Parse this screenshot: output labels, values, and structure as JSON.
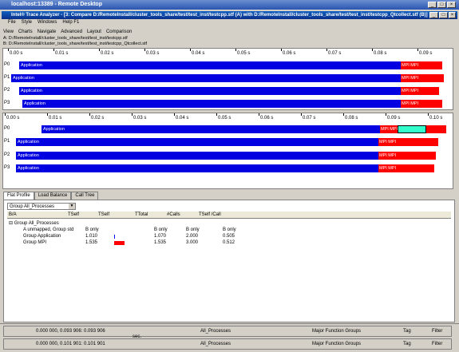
{
  "window_title": "localhost:13389 - Remote Desktop",
  "app_title": "Intel® Trace Analyzer - [3: Compare D:/RemoteInstall/cluster_tools_share/test/test_inst/testcpp.stf (A) with D:/RemoteInstall/cluster_tools_share/test/test_inst/testcpp_Qtcollect.stf (B)]",
  "menu": [
    "File",
    "Style",
    "Windows",
    "Help F1"
  ],
  "view_menu": [
    "View",
    "Charts",
    "Navigate",
    "Advanced",
    "Layout",
    "Comparison"
  ],
  "path_a": "A: D:/RemoteInstall/cluster_tools_share/test/test_inst/testcpp.stf",
  "path_b": "B: D:/RemoteInstall/cluster_tools_share/test/test_inst/testcpp_Qtcollect.stf",
  "top_ticks": [
    "0.00 s",
    "0.01 s",
    "0.02 s",
    "0.03 s",
    "0.04 s",
    "0.05 s",
    "0.06 s",
    "0.07 s",
    "0.08 s",
    "0.09 s"
  ],
  "bottom_ticks": [
    "0.00 s",
    "0.01 s",
    "0.02 s",
    "0.03 s",
    "0.04 s",
    "0.05 s",
    "0.06 s",
    "0.07 s",
    "0.08 s",
    "0.09 s",
    "0.10 s"
  ],
  "processes": [
    "P0",
    "P1",
    "P2",
    "P3"
  ],
  "app_label": "Application",
  "mpi_label": "MPI",
  "tabs": [
    "Flat Profile",
    "Load Balance",
    "Call Tree"
  ],
  "group_select": "Group All_Processes",
  "columns": [
    "B/A",
    "TSelf",
    "TSelf",
    "TTotal",
    "#Calls",
    "TSelf /Call"
  ],
  "rows": [
    {
      "name": "Group All_Processes",
      "a": "",
      "b": "",
      "c": "",
      "d": "",
      "e": ""
    },
    {
      "name": "A unmapped, Group std",
      "a": "B only",
      "b": "",
      "c": "B only",
      "d": "B only",
      "e": "B only"
    },
    {
      "name": "Group Application",
      "a": "1.010",
      "b": "",
      "c": "1.070",
      "d": "2.000",
      "e": "0.505"
    },
    {
      "name": "Group MPI",
      "a": "1.535",
      "b": "",
      "c": "1.535",
      "d": "3.000",
      "e": "0.512"
    }
  ],
  "status_rows": [
    {
      "range": "0.000 000, 0.093 906: 0.093 906",
      "proc": "All_Processes",
      "group": "Major Function Groups",
      "tag": "Tag",
      "filter": "Filter"
    },
    {
      "range": "0.000 000, 0.101 901: 0.101 901",
      "proc": "All_Processes",
      "group": "Major Function Groups",
      "tag": "Tag",
      "filter": "Filter"
    }
  ],
  "sec_label": "sec."
}
